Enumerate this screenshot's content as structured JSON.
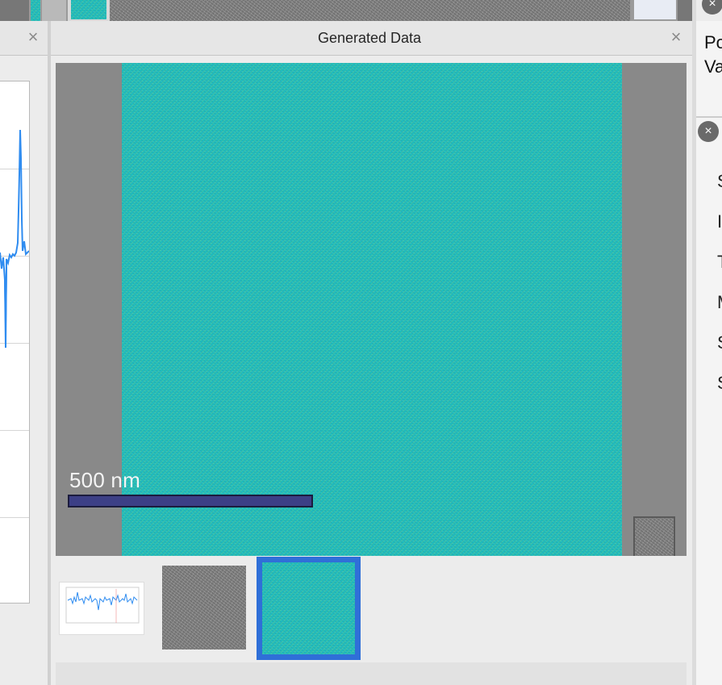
{
  "window": {
    "panel_title": "Generated Data",
    "close_glyph": "×"
  },
  "viewer": {
    "scale_bar_label": "500 nm",
    "colors": {
      "image_teal": "#1fc4c0",
      "scale_bar": "#3c3f86",
      "selected_border": "#2f6fd8"
    }
  },
  "thumbnails": [
    {
      "name": "line-plot-thumbnail",
      "selected": false
    },
    {
      "name": "gray-noise-thumbnail",
      "selected": false
    },
    {
      "name": "teal-noise-thumbnail",
      "selected": true
    }
  ],
  "right_panel": {
    "line1": "Po",
    "line2": "Va",
    "close_glyph": "×",
    "items": [
      "S",
      "I",
      "T",
      "M",
      "S",
      "S"
    ]
  }
}
